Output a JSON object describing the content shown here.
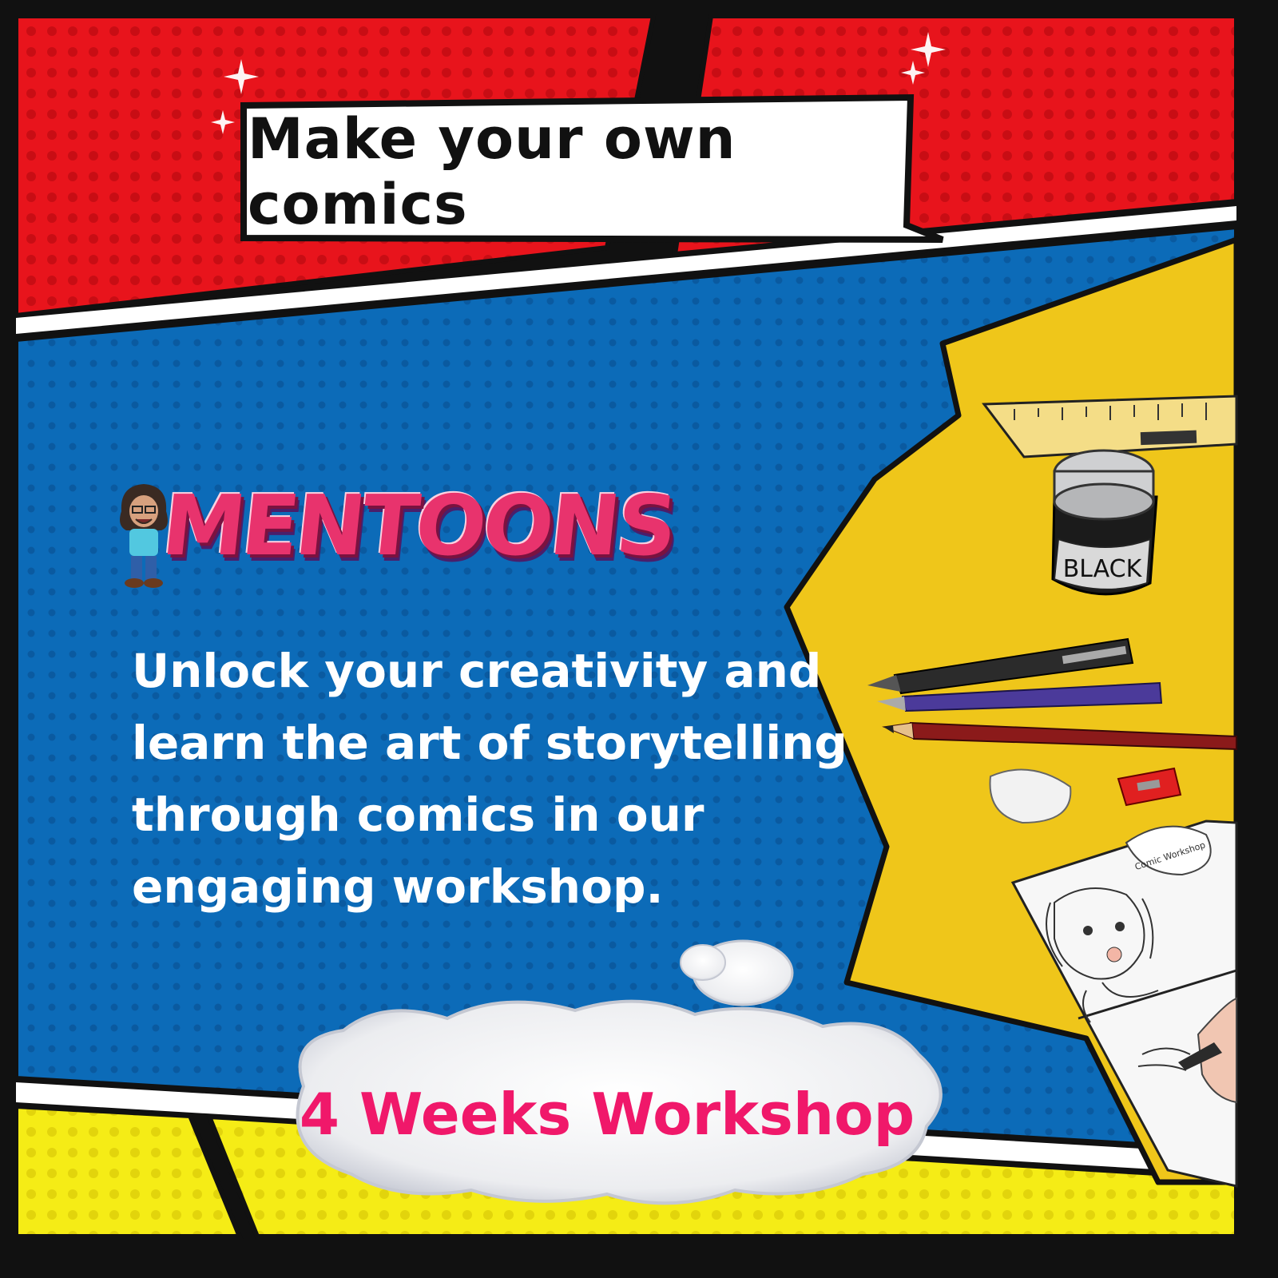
{
  "headline": "Make your own comics",
  "brand": "MENTOONS",
  "tagline": "Unlock your creativity and learn the art of storytelling through comics in our engaging workshop.",
  "cta": "4 Weeks Workshop",
  "ink_jar_label": "BLACK",
  "sketch_caption": "Comic Workshop",
  "colors": {
    "red": "#e8141c",
    "blue": "#0c6bb8",
    "yellow": "#f5ec16",
    "burst": "#efc61a",
    "pink": "#f0186a"
  }
}
